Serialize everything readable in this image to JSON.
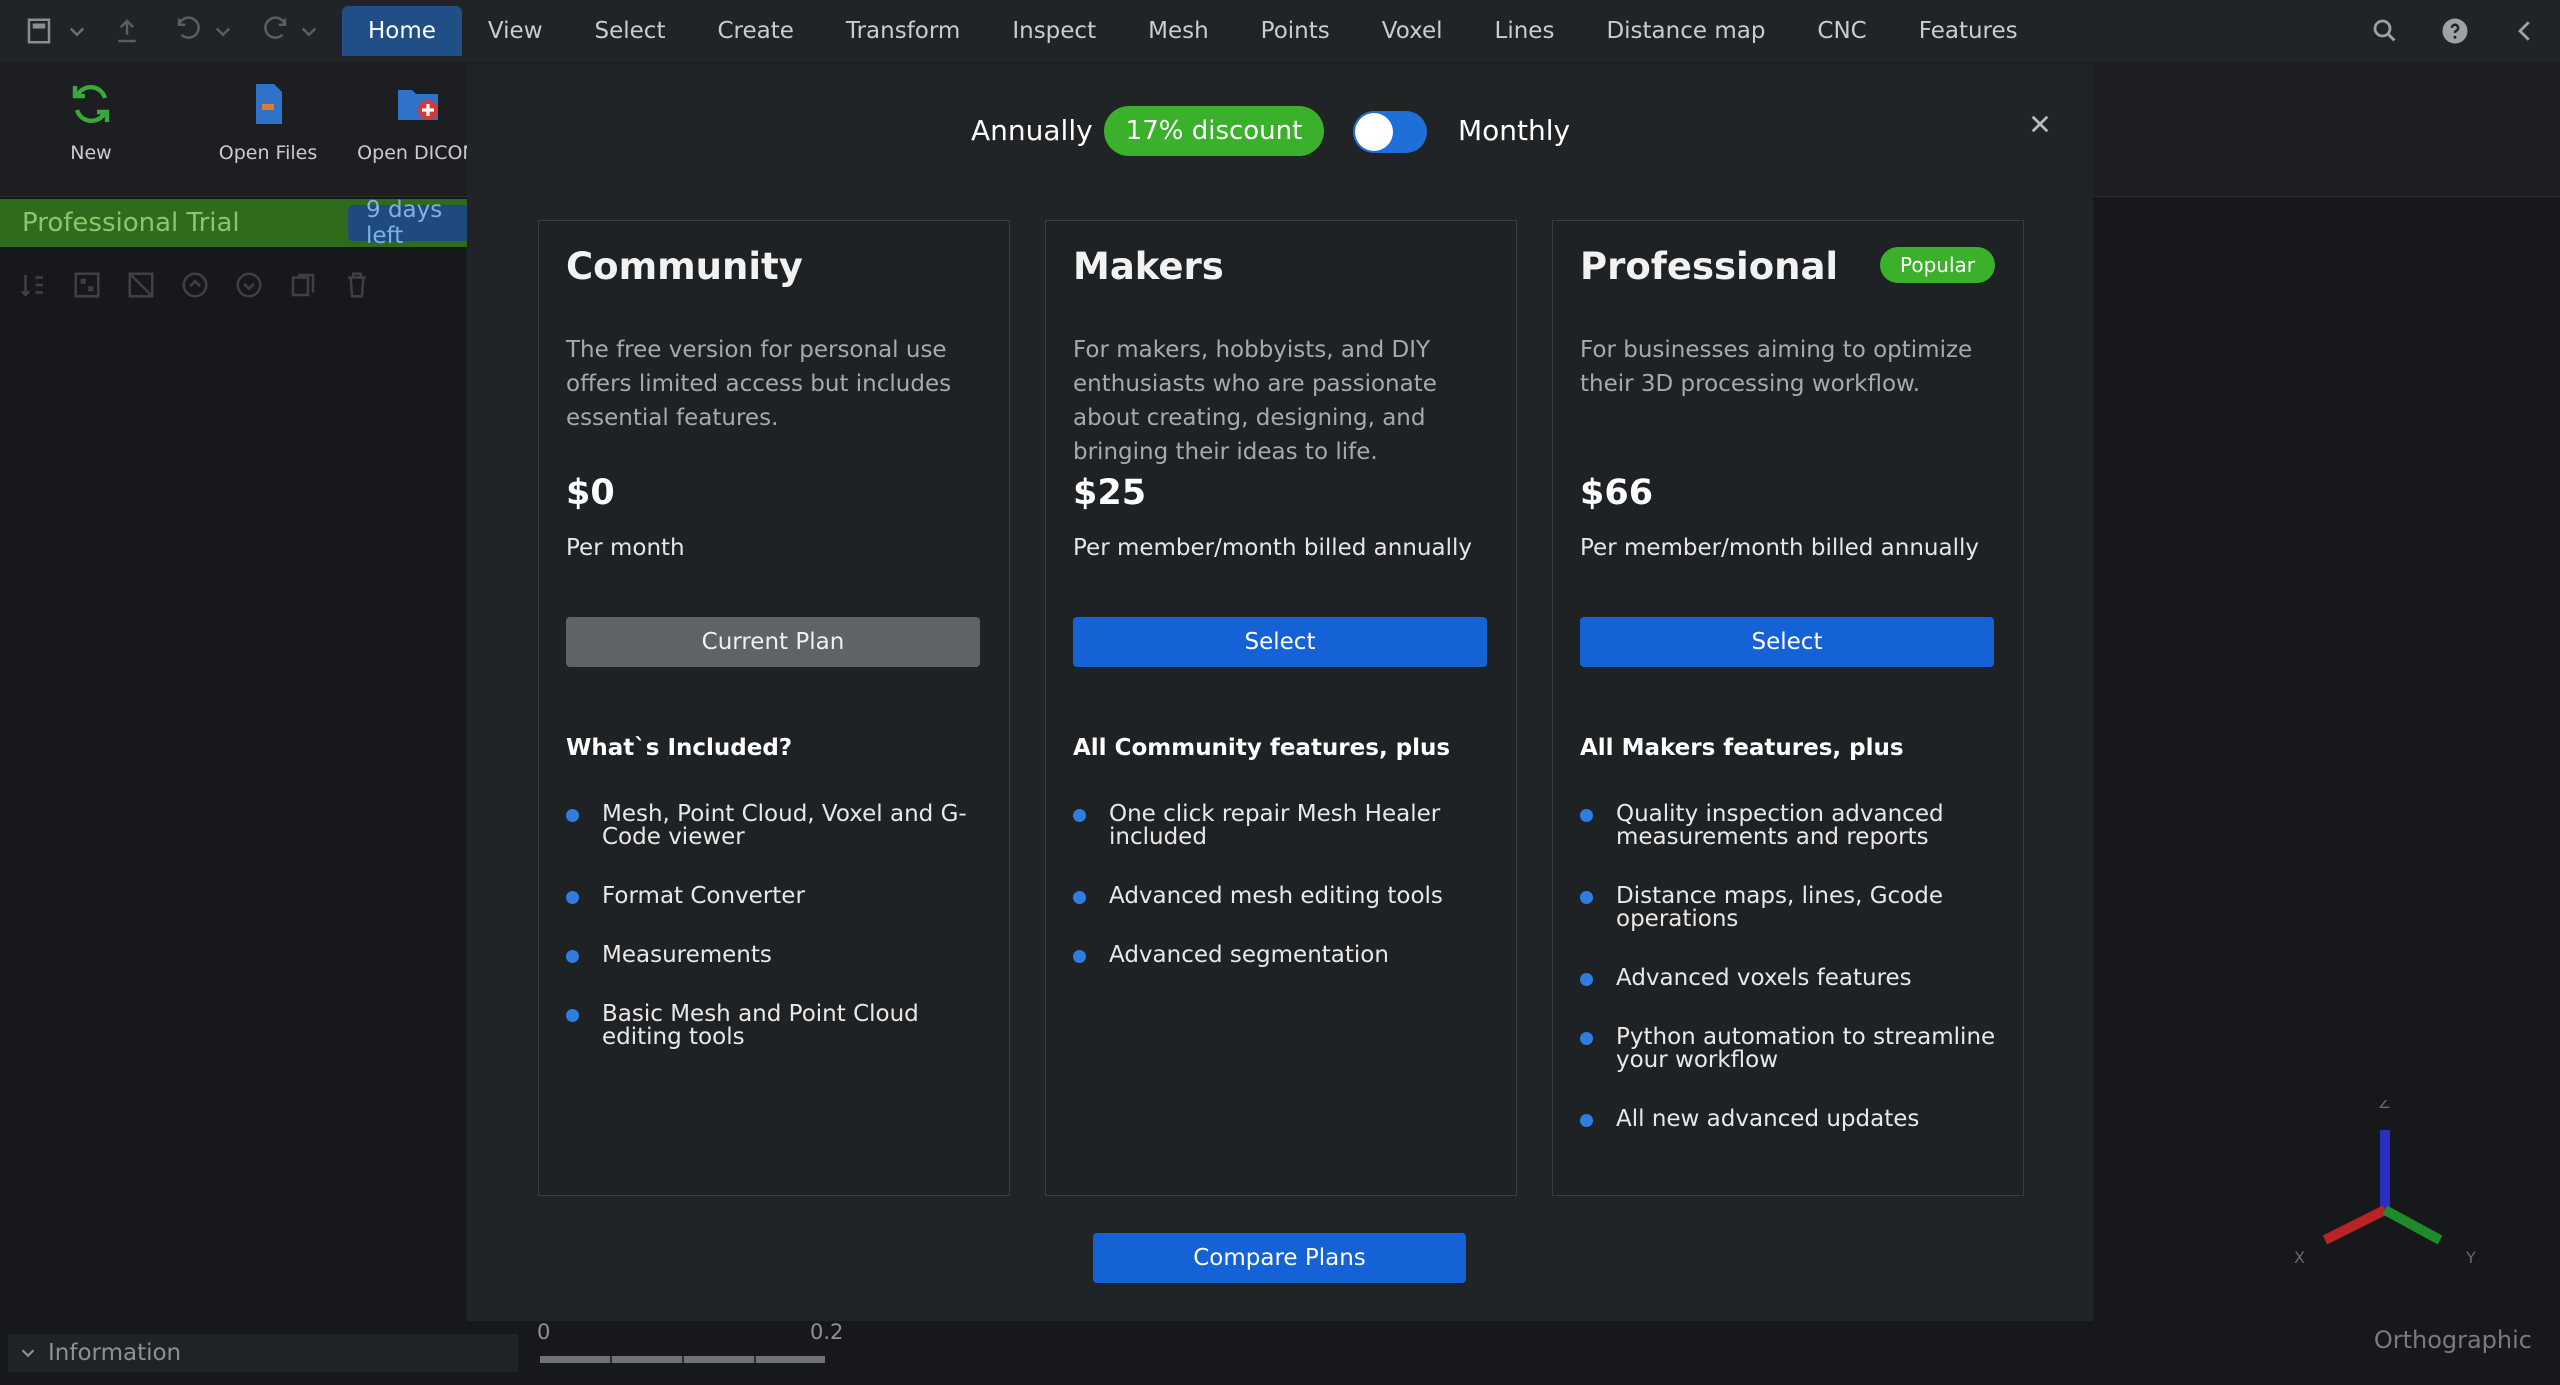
{
  "menubar": {
    "tabs": [
      "Home",
      "View",
      "Select",
      "Create",
      "Transform",
      "Inspect",
      "Mesh",
      "Points",
      "Voxel",
      "Lines",
      "Distance map",
      "CNC",
      "Features"
    ],
    "active_tab": "Home"
  },
  "ribbon": {
    "new_label": "New",
    "open_files_label": "Open Files",
    "open_dicom_label": "Open DICOM"
  },
  "trial": {
    "label": "Professional Trial",
    "days_left": "9 days left"
  },
  "info_panel": {
    "label": "Information"
  },
  "scale": {
    "start": "0",
    "end": "0.2"
  },
  "viewport": {
    "projection": "Orthographic",
    "axis_labels": {
      "x": "X",
      "y": "Y",
      "z": "Z"
    }
  },
  "pricing": {
    "annual_label": "Annually",
    "discount_badge": "17% discount",
    "monthly_label": "Monthly",
    "billing_toggle_on": true,
    "plans": [
      {
        "name": "Community",
        "description": "The free version for personal use offers limited access but includes essential features.",
        "price": "$0",
        "period": "Per month",
        "button": "Current Plan",
        "included_title": "What`s Included?",
        "features": [
          "Mesh, Point Cloud, Voxel and G-Code viewer",
          "Format Converter",
          "Measurements",
          "Basic Mesh and Point Cloud editing tools"
        ]
      },
      {
        "name": "Makers",
        "description": "For makers, hobbyists, and DIY enthusiasts who are passionate about creating, designing, and bringing their ideas to life.",
        "price": "$25",
        "period": "Per member/month billed annually",
        "button": "Select",
        "included_title": "All Community features, plus",
        "features": [
          "One click repair Mesh Healer included",
          "Advanced mesh editing tools",
          "Advanced segmentation"
        ]
      },
      {
        "name": "Professional",
        "badge": "Popular",
        "description": "For businesses aiming to optimize their 3D processing workflow.",
        "price": "$66",
        "period": "Per member/month billed annually",
        "button": "Select",
        "included_title": "All Makers features, plus",
        "features": [
          "Quality inspection advanced measurements and reports",
          "Distance maps, lines, Gcode operations",
          "Advanced voxels features",
          "Python automation to streamline your workflow",
          "All new advanced updates"
        ]
      }
    ],
    "compare_button": "Compare Plans"
  },
  "colors": {
    "accent_blue": "#1561d6",
    "discount_green": "#3bb02b",
    "modal_bg": "#212427",
    "app_bg": "#16181b"
  }
}
